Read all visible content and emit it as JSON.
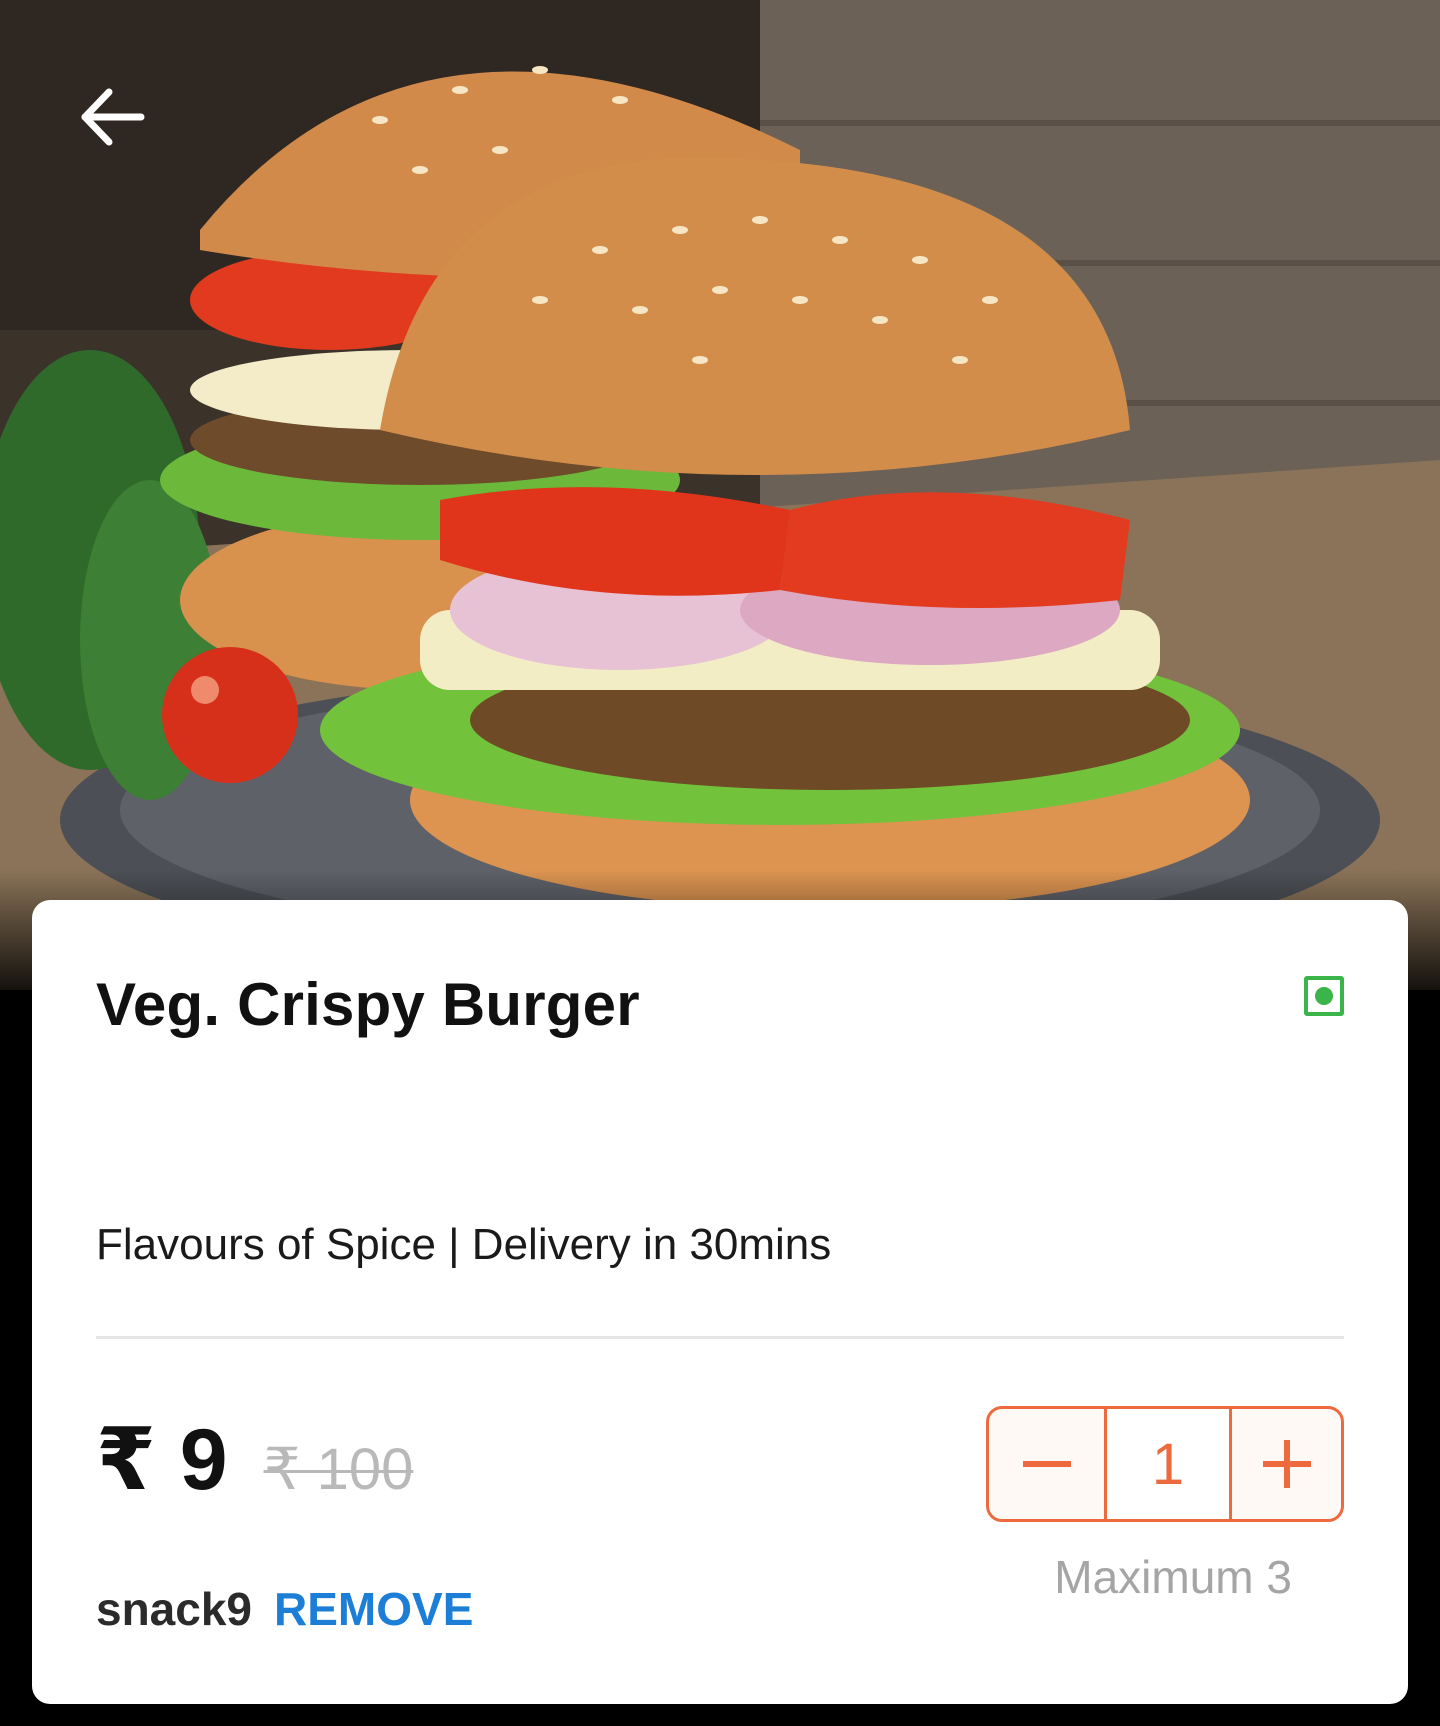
{
  "header": {
    "back_icon": "arrow-left-icon"
  },
  "product": {
    "name": "Veg. Crispy Burger",
    "diet_icon": "veg-indicator-icon",
    "subtitle": "Flavours of Spice | Delivery in 30mins",
    "price": "₹ 9",
    "original_price": "₹ 100"
  },
  "quantity": {
    "minus_icon": "minus-icon",
    "value": "1",
    "plus_icon": "plus-icon",
    "max_note": "Maximum 3"
  },
  "coupon": {
    "code": "snack9",
    "remove_label": "REMOVE"
  },
  "colors": {
    "veg_green": "#3bb54a",
    "accent_orange": "#ec6a3e",
    "link_blue": "#1c7ed6"
  }
}
